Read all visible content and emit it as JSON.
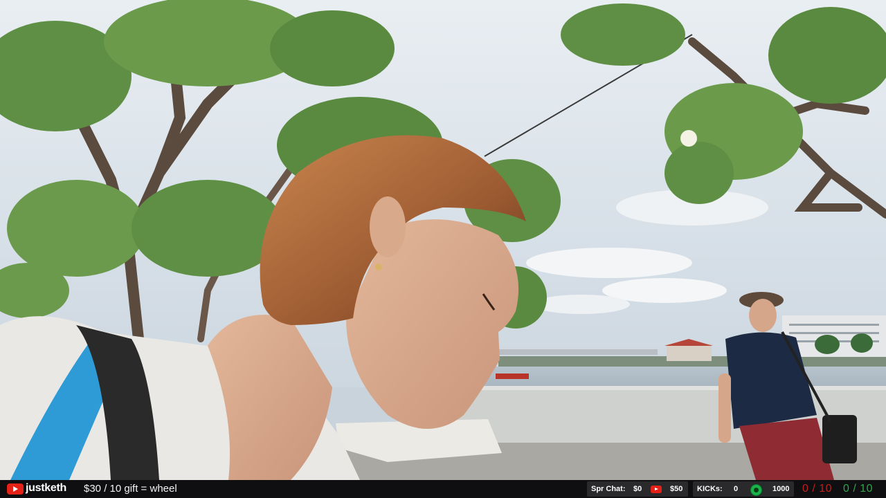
{
  "stream_overlay": {
    "channel": "justketh",
    "gift_goal": "$30 / 10 gift = wheel",
    "spr_chat_label": "Spr Chat:",
    "spr_chat_value": "$0",
    "spr_chat_yt_value": "$50",
    "kicks_label": "KICKs:",
    "kicks_value": "0",
    "kicks_target": "1000",
    "counter_red": "0 / 10",
    "counter_green": "0 / 10",
    "colors": {
      "bar_bg": "#0f0f11",
      "youtube_red": "#e62117",
      "counter_red": "#c21e1e",
      "counter_green": "#2fa54a"
    }
  },
  "icons": {
    "channel_icon": "youtube-icon",
    "spr_chat_icon": "youtube-icon",
    "kicks_icon": "kick-icon"
  }
}
